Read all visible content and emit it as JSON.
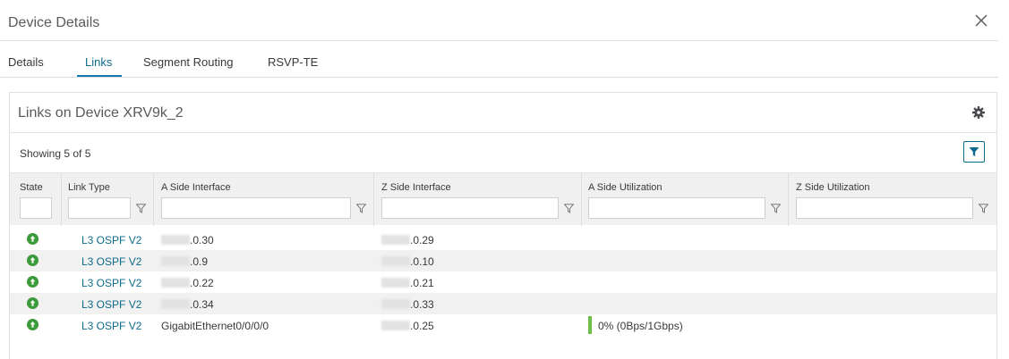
{
  "dialog": {
    "title": "Device Details"
  },
  "tabs": [
    {
      "label": "Details"
    },
    {
      "label": "Links",
      "active": true
    },
    {
      "label": "Segment Routing"
    },
    {
      "label": "RSVP-TE"
    }
  ],
  "card": {
    "title": "Links on Device XRV9k_2",
    "showing": "Showing 5 of 5"
  },
  "table": {
    "columns": [
      "State",
      "Link Type",
      "A Side Interface",
      "Z Side Interface",
      "A Side Utilization",
      "Z Side Utilization"
    ],
    "rows": [
      {
        "state": "up",
        "link_type": "L3 OSPF V2",
        "a_side": ".0.30",
        "z_side": ".0.29",
        "a_util": "",
        "z_util": ""
      },
      {
        "state": "up",
        "link_type": "L3 OSPF V2",
        "a_side": ".0.9",
        "z_side": ".0.10",
        "a_util": "",
        "z_util": ""
      },
      {
        "state": "up",
        "link_type": "L3 OSPF V2",
        "a_side": ".0.22",
        "z_side": ".0.21",
        "a_util": "",
        "z_util": ""
      },
      {
        "state": "up",
        "link_type": "L3 OSPF V2",
        "a_side": ".0.34",
        "z_side": ".0.33",
        "a_util": "",
        "z_util": ""
      },
      {
        "state": "up",
        "link_type": "L3 OSPF V2",
        "a_side": "GigabitEthernet0/0/0/0",
        "z_side": ".0.25",
        "a_util": "0% (0Bps/1Gbps)",
        "z_util": ""
      }
    ]
  },
  "colors": {
    "accent": "#0d6b8a",
    "status_up": "#3a9b3a",
    "util_bar": "#6cc04a"
  },
  "icons": {
    "close": "close-icon",
    "settings": "gear-icon",
    "filter": "filter-icon",
    "state": "arrow-up-circle-icon"
  }
}
